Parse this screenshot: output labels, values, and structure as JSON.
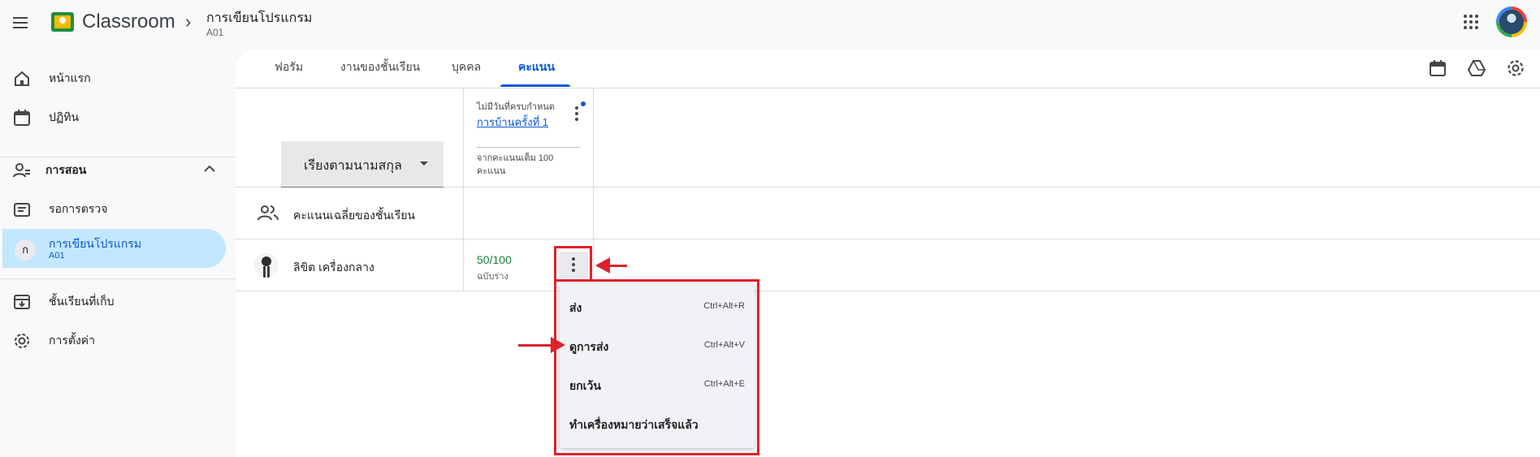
{
  "header": {
    "app_title": "Classroom",
    "class_name": "การเขียนโปรแกรม",
    "class_section": "A01"
  },
  "sidebar": {
    "home": "หน้าแรก",
    "calendar": "ปฏิทิน",
    "teaching": "การสอน",
    "to_review": "รอการตรวจ",
    "active_class": {
      "letter": "ก",
      "name": "การเขียนโปรแกรม",
      "section": "A01"
    },
    "archived": "ชั้นเรียนที่เก็บ",
    "settings": "การตั้งค่า"
  },
  "tabs": {
    "stream": "ฟอรัม",
    "classwork": "งานของชั้นเรียน",
    "people": "บุคคล",
    "grades": "คะแนน"
  },
  "grades": {
    "sort_label": "เรียงตามนามสกุล",
    "assignment": {
      "due": "ไม่มีวันที่ครบกำหนด",
      "title": "การบ้านครั้งที่ 1",
      "points": "จากคะแนนเต็ม 100 คะแนน"
    },
    "class_average_label": "คะแนนเฉลี่ยของชั้นเรียน",
    "student": {
      "name": "ลิขิต เครื่องกลาง",
      "score": "50/100",
      "status": "ฉบับร่าง"
    }
  },
  "context_menu": {
    "items": [
      {
        "label": "ส่ง",
        "shortcut": "Ctrl+Alt+R"
      },
      {
        "label": "ดูการส่ง",
        "shortcut": "Ctrl+Alt+V"
      },
      {
        "label": "ยกเว้น",
        "shortcut": "Ctrl+Alt+E"
      },
      {
        "label": "ทำเครื่องหมายว่าเสร็จแล้ว",
        "shortcut": ""
      }
    ]
  },
  "colors": {
    "accent": "#0b57d0",
    "active_nav": "#c2e7ff",
    "score_green": "#188038",
    "annotation_red": "#e0212b"
  }
}
